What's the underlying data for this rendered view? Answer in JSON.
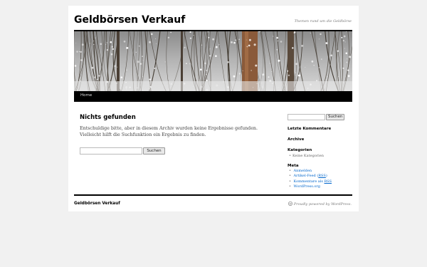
{
  "site": {
    "title": "Geldbörsen Verkauf",
    "description": "Themen rund um die Geldbörse"
  },
  "nav": {
    "home_label": "Home"
  },
  "content": {
    "title": "Nichts gefunden",
    "line1": "Entschuldige bitte, aber in diesem Archiv wurden keine Ergebnisse gefunden.",
    "line2": "Vielleicht hilft die Suchfunktion ein Ergebnis zu finden.",
    "search_value": "",
    "search_button": "Suchen"
  },
  "sidebar": {
    "search_value": "",
    "search_button": "Suchen",
    "recent_comments_title": "Letzte Kommentare",
    "archive_title": "Archive",
    "categories_title": "Kategorien",
    "categories_items": [
      "Keine Kategorien"
    ],
    "meta_title": "Meta",
    "meta_items": [
      {
        "label": "Anmelden"
      },
      {
        "pre": "Artikel-Feed (",
        "abbr": "RSS",
        "post": ")"
      },
      {
        "pre": "Kommentare als ",
        "abbr": "RSS",
        "post": ""
      },
      {
        "label": "WordPress.org"
      }
    ]
  },
  "footer": {
    "title": "Geldbörsen Verkauf",
    "powered": "Proudly powered by WordPress."
  },
  "icons": {
    "footer": "wordpress-icon"
  }
}
